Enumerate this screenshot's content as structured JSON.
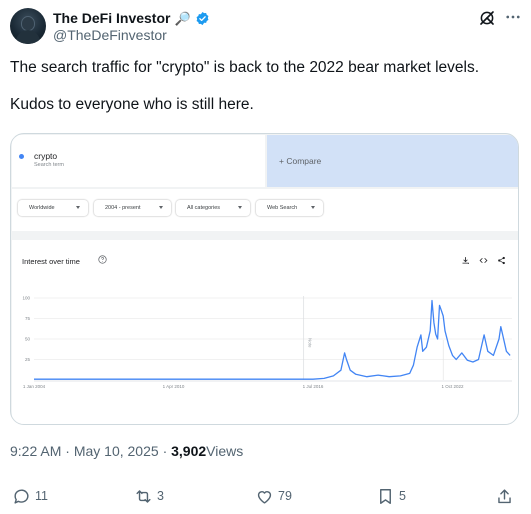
{
  "author": {
    "display_name": "The DeFi Investor",
    "name_emoji": "🔎",
    "handle": "@TheDeFinvestor",
    "verified_color": "#1d9bf0"
  },
  "header_icons": [
    "grok-icon",
    "more-icon"
  ],
  "tweet": {
    "line1": "The search traffic for \"crypto\" is back to the 2022 bear market levels.",
    "line2": "Kudos to everyone who is still here."
  },
  "trends_card": {
    "search_term": "crypto",
    "search_sub": "Search term",
    "compare_label": "+   Compare",
    "filters": [
      "Worldwide",
      "2004 - present",
      "All categories",
      "Web Search"
    ],
    "chart_title": "Interest over time",
    "accent": "#4285f4",
    "chart_data": {
      "type": "line",
      "title": "Interest over time",
      "xlabel": "",
      "ylabel": "",
      "ylim": [
        0,
        100
      ],
      "yticks": [
        "100",
        "75",
        "50",
        "25"
      ],
      "xticks": [
        "1 Jan 2004",
        "1 Apr 2010",
        "1 Jul 2016",
        "1 Oct 2022"
      ],
      "annotation": "Note",
      "grid": true,
      "series": [
        {
          "color": "#4285f4",
          "points": [
            [
              "2004-01",
              1
            ],
            [
              "2006-01",
              1
            ],
            [
              "2008-01",
              1
            ],
            [
              "2010-01",
              1
            ],
            [
              "2012-01",
              1
            ],
            [
              "2014-01",
              1
            ],
            [
              "2016-01",
              1
            ],
            [
              "2016-07",
              1
            ],
            [
              "2017-01",
              2
            ],
            [
              "2017-06",
              5
            ],
            [
              "2017-10",
              12
            ],
            [
              "2017-12",
              33
            ],
            [
              "2018-01",
              25
            ],
            [
              "2018-03",
              12
            ],
            [
              "2018-06",
              7
            ],
            [
              "2018-12",
              4
            ],
            [
              "2019-06",
              6
            ],
            [
              "2019-12",
              4
            ],
            [
              "2020-06",
              5
            ],
            [
              "2020-11",
              8
            ],
            [
              "2021-01",
              18
            ],
            [
              "2021-03",
              40
            ],
            [
              "2021-05",
              55
            ],
            [
              "2021-06",
              35
            ],
            [
              "2021-08",
              40
            ],
            [
              "2021-10",
              60
            ],
            [
              "2021-11",
              97
            ],
            [
              "2021-12",
              70
            ],
            [
              "2022-01",
              56
            ],
            [
              "2022-02",
              50
            ],
            [
              "2022-03",
              91
            ],
            [
              "2022-04",
              85
            ],
            [
              "2022-05",
              78
            ],
            [
              "2022-06",
              60
            ],
            [
              "2022-08",
              42
            ],
            [
              "2022-10",
              30
            ],
            [
              "2022-12",
              25
            ],
            [
              "2023-03",
              33
            ],
            [
              "2023-06",
              24
            ],
            [
              "2023-09",
              22
            ],
            [
              "2023-12",
              25
            ],
            [
              "2024-03",
              55
            ],
            [
              "2024-05",
              35
            ],
            [
              "2024-08",
              30
            ],
            [
              "2024-11",
              50
            ],
            [
              "2024-12",
              65
            ],
            [
              "2025-01",
              55
            ],
            [
              "2025-03",
              35
            ],
            [
              "2025-05",
              30
            ]
          ]
        }
      ]
    }
  },
  "meta": {
    "time": "9:22 AM",
    "sep": "·",
    "date": "May 10, 2025",
    "views_count": "3,902",
    "views_label": "Views"
  },
  "actions": {
    "replies": "11",
    "reposts": "3",
    "likes": "79",
    "bookmarks": "5"
  }
}
